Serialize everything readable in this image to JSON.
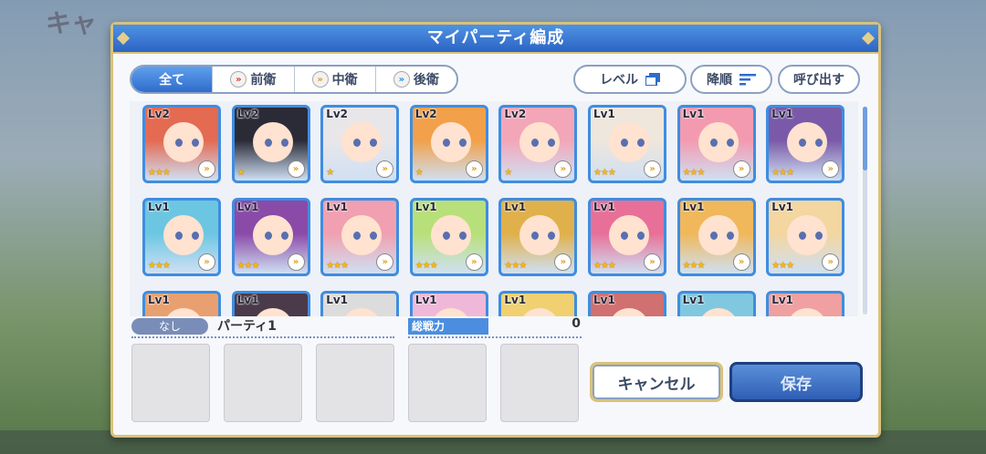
{
  "background": {
    "title": "キャ"
  },
  "dialog": {
    "title": "マイパーティ編成",
    "tabs": [
      {
        "label": "全て",
        "active": true
      },
      {
        "label": "前衛",
        "active": false
      },
      {
        "label": "中衛",
        "active": false
      },
      {
        "label": "後衛",
        "active": false
      }
    ],
    "sort_level_label": "レベル",
    "sort_order_label": "降順",
    "recall_label": "呼び出す",
    "characters": [
      {
        "level": "Lv2",
        "stars": "★★★",
        "color": "#e46a52"
      },
      {
        "level": "Lv2",
        "stars": "★",
        "color": "#2b2b38"
      },
      {
        "level": "Lv2",
        "stars": "★",
        "color": "#e9e6ea"
      },
      {
        "level": "Lv2",
        "stars": "★",
        "color": "#f2a04a"
      },
      {
        "level": "Lv2",
        "stars": "★",
        "color": "#f3a6b8"
      },
      {
        "level": "Lv1",
        "stars": "★★★",
        "color": "#efe6dc"
      },
      {
        "level": "Lv1",
        "stars": "★★★",
        "color": "#f39ab0"
      },
      {
        "level": "Lv1",
        "stars": "★★★",
        "color": "#7a5aa8"
      },
      {
        "level": "Lv1",
        "stars": "★★★",
        "color": "#6cc6e2"
      },
      {
        "level": "Lv1",
        "stars": "★★★",
        "color": "#8a4aa8"
      },
      {
        "level": "Lv1",
        "stars": "★★★",
        "color": "#f0a0b0"
      },
      {
        "level": "Lv1",
        "stars": "★★★",
        "color": "#b8e07a"
      },
      {
        "level": "Lv1",
        "stars": "★★★",
        "color": "#e0b04a"
      },
      {
        "level": "Lv1",
        "stars": "★★★",
        "color": "#e87098"
      },
      {
        "level": "Lv1",
        "stars": "★★★",
        "color": "#f0b85a"
      },
      {
        "level": "Lv1",
        "stars": "★★★",
        "color": "#f3d6a0"
      },
      {
        "level": "Lv1",
        "stars": "",
        "color": "#e8a070"
      },
      {
        "level": "Lv1",
        "stars": "",
        "color": "#4a3a4a"
      },
      {
        "level": "Lv1",
        "stars": "",
        "color": "#dcdcdc"
      },
      {
        "level": "Lv1",
        "stars": "",
        "color": "#f0b8d8"
      },
      {
        "level": "Lv1",
        "stars": "",
        "color": "#f0d070"
      },
      {
        "level": "Lv1",
        "stars": "",
        "color": "#d07070"
      },
      {
        "level": "Lv1",
        "stars": "",
        "color": "#80c8e0"
      },
      {
        "level": "Lv1",
        "stars": "",
        "color": "#f0a0a0"
      }
    ],
    "party": {
      "tag": "なし",
      "name": "パーティ1",
      "power_label": "総戦力",
      "power_value": "0",
      "slots": 5
    },
    "cancel_label": "キャンセル",
    "save_label": "保存"
  }
}
